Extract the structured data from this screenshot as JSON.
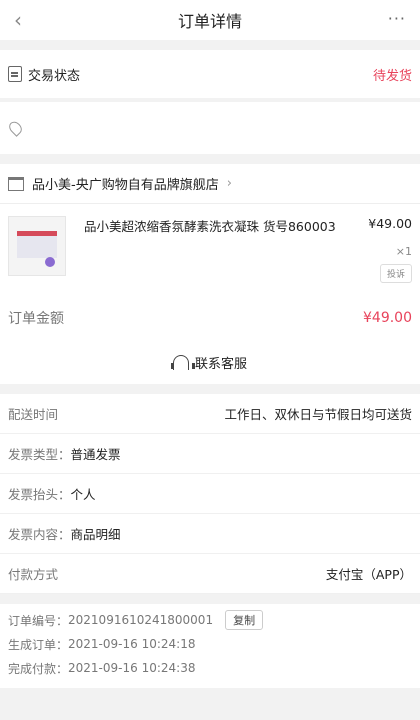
{
  "header": {
    "back": "‹",
    "title": "订单详情",
    "more": "···"
  },
  "status": {
    "label": "交易状态",
    "value": "待发货"
  },
  "shop": {
    "name": "品小美-央广购物自有品牌旗舰店",
    "chev": "›"
  },
  "product": {
    "title": "品小美超浓缩香氛酵素洗衣凝珠 货号860003",
    "price": "¥49.00",
    "qty": "×1",
    "invoice_button": "投诉"
  },
  "order_amount": {
    "label": "订单金额",
    "value": "¥49.00"
  },
  "service": {
    "label": "联系客服"
  },
  "info": {
    "delivery_label": "配送时间",
    "delivery_value": "工作日、双休日与节假日均可送货",
    "invoice_type_label": "发票类型：",
    "invoice_type_value": "普通发票",
    "invoice_head_label": "发票抬头：",
    "invoice_head_value": "个人",
    "invoice_content_label": "发票内容：",
    "invoice_content_value": "商品明细",
    "payment_label": "付款方式",
    "payment_value": "支付宝（APP）"
  },
  "order": {
    "number_label": "订单编号：",
    "number_value": "2021091610241800001",
    "copy": "复制",
    "created_label": "生成订单：",
    "created_value": "2021-09-16 10:24:18",
    "paid_label": "完成付款：",
    "paid_value": "2021-09-16 10:24:38"
  },
  "colors": {
    "accent": "#e8435b"
  }
}
